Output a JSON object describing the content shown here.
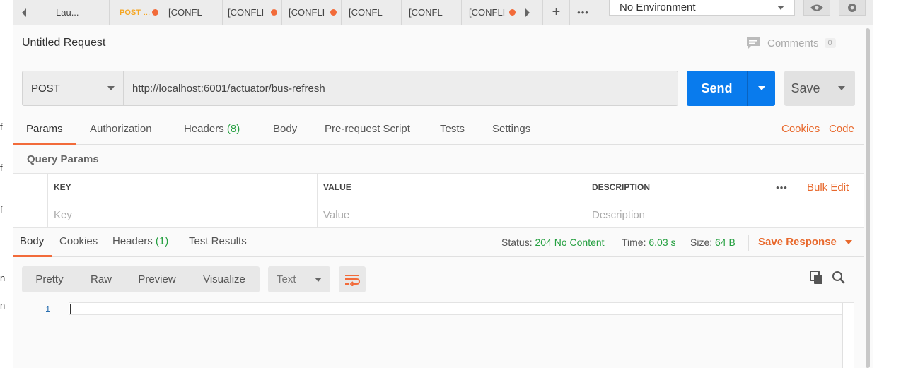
{
  "left_fragments": [
    "f",
    "f",
    "f",
    "n",
    "n"
  ],
  "tabs": [
    {
      "label": "Lau...",
      "method": "",
      "unsaved": false
    },
    {
      "label": "...",
      "method": "POST",
      "unsaved": true
    },
    {
      "label": "[CONFL",
      "method": "",
      "unsaved": false
    },
    {
      "label": "[CONFLI",
      "method": "",
      "unsaved": true
    },
    {
      "label": "[CONFLI",
      "method": "",
      "unsaved": true
    },
    {
      "label": "[CONFL",
      "method": "",
      "unsaved": false
    },
    {
      "label": "[CONFL",
      "method": "",
      "unsaved": false
    },
    {
      "label": "[CONFLI",
      "method": "",
      "unsaved": true
    }
  ],
  "tabbar": {
    "add": "+",
    "more": "•••"
  },
  "environment": {
    "selected": "No Environment"
  },
  "request": {
    "title": "Untitled Request",
    "comments_label": "Comments",
    "comments_count": "0",
    "method": "POST",
    "url": "http://localhost:6001/actuator/bus-refresh",
    "send_label": "Send",
    "save_label": "Save"
  },
  "request_tabs": {
    "params": "Params",
    "authorization": "Authorization",
    "headers": "Headers",
    "headers_count": "(8)",
    "body": "Body",
    "prerequest": "Pre-request Script",
    "tests": "Tests",
    "settings": "Settings",
    "cookies": "Cookies",
    "code": "Code"
  },
  "query_params": {
    "title": "Query Params",
    "columns": [
      "KEY",
      "VALUE",
      "DESCRIPTION"
    ],
    "more": "•••",
    "bulk_edit": "Bulk Edit",
    "placeholders": [
      "Key",
      "Value",
      "Description"
    ]
  },
  "response_tabs": {
    "body": "Body",
    "cookies": "Cookies",
    "headers": "Headers",
    "headers_count": "(1)",
    "test_results": "Test Results"
  },
  "response_status": {
    "status_label": "Status:",
    "status_value": "204 No Content",
    "time_label": "Time:",
    "time_value": "6.03 s",
    "size_label": "Size:",
    "size_value": "64 B",
    "save_response": "Save Response"
  },
  "viewer": {
    "formats": [
      "Pretty",
      "Raw",
      "Preview",
      "Visualize"
    ],
    "language": "Text",
    "line_numbers": [
      "1"
    ]
  },
  "colors": {
    "accent": "#f26b3a",
    "send": "#097bed",
    "success": "#26a041"
  }
}
